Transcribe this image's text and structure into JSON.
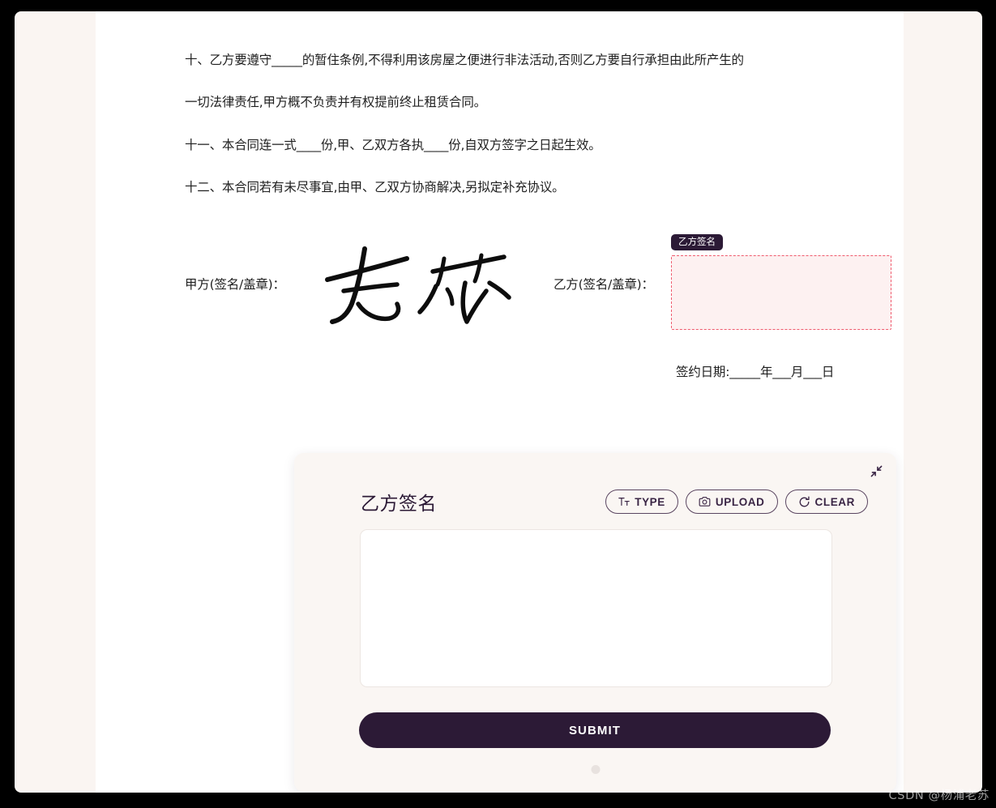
{
  "document": {
    "clauses": [
      "十、乙方要遵守_____的暂住条例,不得利用该房屋之便进行非法活动,否则乙方要自行承担由此所产生的",
      "一切法律责任,甲方概不负责并有权提前终止租赁合同。",
      "十一、本合同连一式____份,甲、乙双方各执____份,自双方签字之日起生效。",
      "十二、本合同若有未尽事宜,由甲、乙双方协商解决,另拟定补充协议。"
    ],
    "party_a_label": "甲方(签名/盖章)：",
    "party_a_signature_name": "老苏",
    "party_b_label": "乙方(签名/盖章)：",
    "party_b_badge": "乙方签名",
    "party_b_dropzone_value": "",
    "date_line": "签约日期:_____年___月___日"
  },
  "signature_panel": {
    "title": "乙方签名",
    "collapse_icon": "collapse-diagonal-icon",
    "actions": [
      {
        "label": "TYPE",
        "icon": "text-format-icon"
      },
      {
        "label": "UPLOAD",
        "icon": "camera-icon"
      },
      {
        "label": "CLEAR",
        "icon": "refresh-icon"
      }
    ],
    "canvas_value": "",
    "submit_label": "SUBMIT",
    "page_indicator_count": 1
  },
  "watermark": "CSDN @杨浦老苏",
  "colors": {
    "accent_dark": "#2c1a36",
    "panel_bg": "#faf6f3",
    "page_bg": "#faf5f2",
    "document_bg": "#ffffff",
    "dropzone_border": "#ef5b6e",
    "dropzone_fill": "#fdf1f1",
    "frame": "#000000"
  }
}
